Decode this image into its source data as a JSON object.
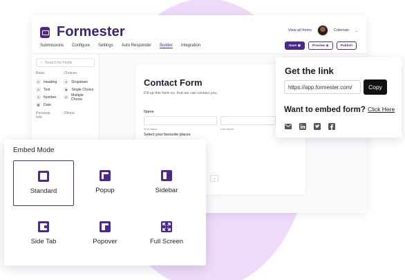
{
  "colors": {
    "brand": "#4b2a8a",
    "blob": "#f0dafa",
    "copy_button": "#111111"
  },
  "builder": {
    "brand_name": "Formester",
    "view_all_forms": "View all forms",
    "user_name": "Coleman",
    "nav": [
      "Submissions",
      "Configure",
      "Settings",
      "Auto Responder",
      "Builder",
      "Integration"
    ],
    "active_nav": "Builder",
    "buttons": {
      "save": "Save",
      "preview": "Preview",
      "publish": "Publish"
    },
    "sidebar": {
      "search_placeholder": "Search for Fields",
      "basic_header": "Basic",
      "choices_header": "Choices",
      "basic": [
        "Heading",
        "Text",
        "Number",
        "Date"
      ],
      "choices": [
        "Dropdown",
        "Single Choice",
        "Multiple Choice"
      ],
      "personal_header": "Personal Info",
      "others_header": "Others"
    },
    "form": {
      "title": "Contact Form",
      "subtitle": "Fill up this form so, that we can contact you.",
      "name_label": "Name",
      "first_caption": "First Name",
      "last_caption": "Last Name",
      "select_label": "Select your favourite places"
    }
  },
  "link_card": {
    "title": "Get the link",
    "url": "https://app.formester.com/",
    "copy_label": "Copy",
    "embed_question": "Want to embed form?",
    "embed_link": "Click Here",
    "share_icons": [
      "email-icon",
      "linkedin-icon",
      "twitter-icon",
      "facebook-icon"
    ]
  },
  "embed_mode": {
    "title": "Embed Mode",
    "selected": "Standard",
    "options": [
      {
        "label": "Standard",
        "icon": "standard-icon"
      },
      {
        "label": "Popup",
        "icon": "popup-icon"
      },
      {
        "label": "Sidebar",
        "icon": "sidebar-icon"
      },
      {
        "label": "Side Tab",
        "icon": "side-tab-icon"
      },
      {
        "label": "Popover",
        "icon": "popover-icon"
      },
      {
        "label": "Full Screen",
        "icon": "full-screen-icon"
      }
    ]
  }
}
